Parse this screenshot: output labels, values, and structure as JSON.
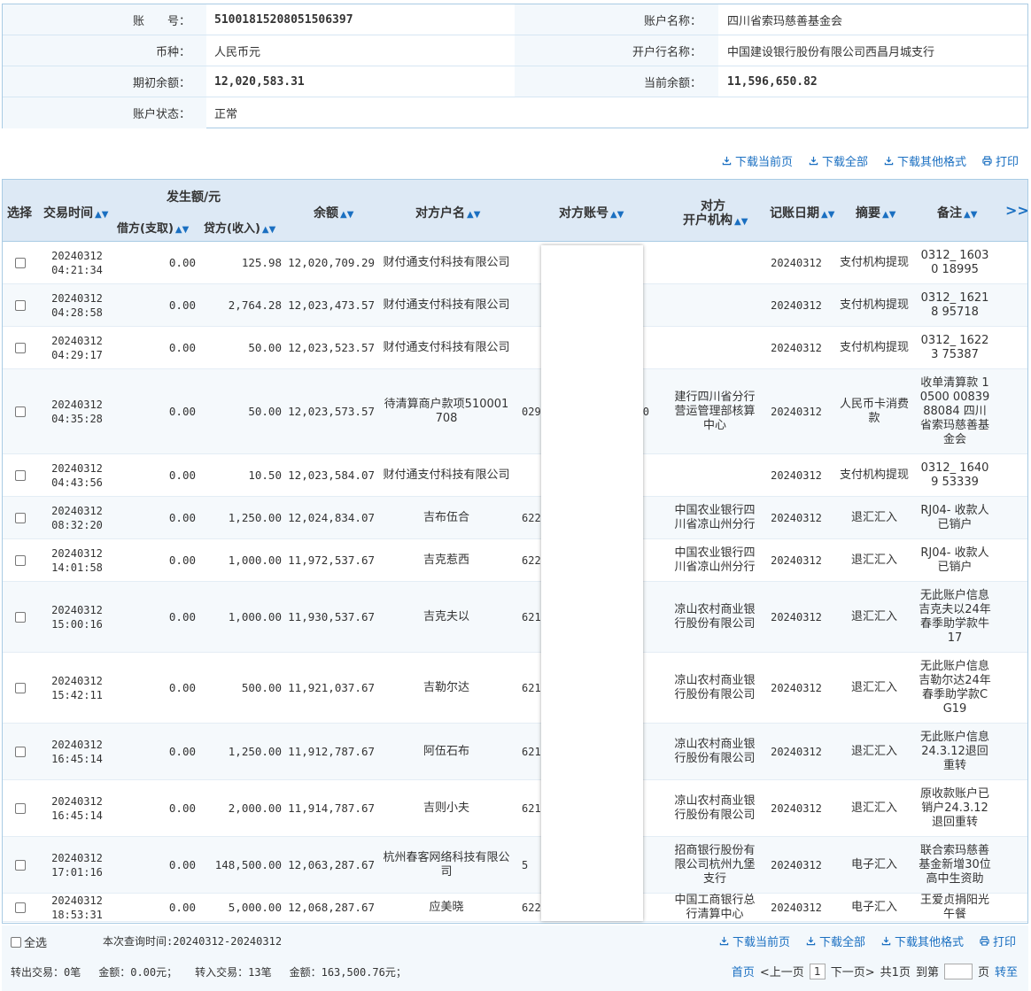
{
  "account": {
    "acct_no_label": "账　　号：",
    "acct_no": "51001815208051506397",
    "acct_name_label": "账户名称：",
    "acct_name": "四川省索玛慈善基金会",
    "currency_label": "币种：",
    "currency": "人民币元",
    "bank_label": "开户行名称：",
    "bank": "中国建设银行股份有限公司西昌月城支行",
    "open_bal_label": "期初余额：",
    "open_bal": "12,020,583.31",
    "cur_bal_label": "当前余额：",
    "cur_bal": "11,596,650.82",
    "status_label": "账户状态：",
    "status": "正常"
  },
  "toolbar": {
    "download_page": "下载当前页",
    "download_all": "下载全部",
    "download_other": "下载其他格式",
    "print": "打印"
  },
  "table": {
    "headers": {
      "select": "选择",
      "time": "交易时间",
      "amount_group": "发生额/元",
      "debit": "借方(支取)",
      "credit": "贷方(收入)",
      "balance": "余额",
      "cp_name": "对方户名",
      "cp_acct": "对方账号",
      "cp_bank_1": "对方",
      "cp_bank_2": "开户机构",
      "post_date": "记账日期",
      "summary": "摘要",
      "remark": "备注",
      "more": ">>"
    },
    "rows": [
      {
        "date": "20240312",
        "time": "04:21:34",
        "debit": "0.00",
        "credit": "125.98",
        "balance": "12,020,709.29",
        "cp_name": "财付通支付科技有限公司",
        "cp_acct": "",
        "cp_bank": "",
        "post_date": "20240312",
        "summary": "支付机构提现",
        "remark": "0312_ 16030 18995"
      },
      {
        "date": "20240312",
        "time": "04:28:58",
        "debit": "0.00",
        "credit": "2,764.28",
        "balance": "12,023,473.57",
        "cp_name": "财付通支付科技有限公司",
        "cp_acct": "",
        "cp_bank": "",
        "post_date": "20240312",
        "summary": "支付机构提现",
        "remark": "0312_ 16218 95718"
      },
      {
        "date": "20240312",
        "time": "04:29:17",
        "debit": "0.00",
        "credit": "50.00",
        "balance": "12,023,523.57",
        "cp_name": "财付通支付科技有限公司",
        "cp_acct": "",
        "cp_bank": "",
        "post_date": "20240312",
        "summary": "支付机构提现",
        "remark": "0312_ 16223 75387"
      },
      {
        "date": "20240312",
        "time": "04:35:28",
        "debit": "0.00",
        "credit": "50.00",
        "balance": "12,023,573.57",
        "cp_name": "待清算商户款项510001708",
        "cp_acct": "029",
        "cp_acct_tail": "0",
        "cp_bank": "建行四川省分行营运管理部核算中心",
        "post_date": "20240312",
        "summary": "人民币卡消费款",
        "remark": "收单清算款 10500 00839 88084 四川省索玛慈善基金会"
      },
      {
        "date": "20240312",
        "time": "04:43:56",
        "debit": "0.00",
        "credit": "10.50",
        "balance": "12,023,584.07",
        "cp_name": "财付通支付科技有限公司",
        "cp_acct": "",
        "cp_bank": "",
        "post_date": "20240312",
        "summary": "支付机构提现",
        "remark": "0312_ 16409 53339"
      },
      {
        "date": "20240312",
        "time": "08:32:20",
        "debit": "0.00",
        "credit": "1,250.00",
        "balance": "12,024,834.07",
        "cp_name": "吉布伍合",
        "cp_acct": "622",
        "cp_bank": "中国农业银行四川省凉山州分行",
        "post_date": "20240312",
        "summary": "退汇汇入",
        "remark": "RJ04- 收款人已销户"
      },
      {
        "date": "20240312",
        "time": "14:01:58",
        "debit": "0.00",
        "credit": "1,000.00",
        "balance": "11,972,537.67",
        "cp_name": "吉克惹西",
        "cp_acct": "622",
        "cp_bank": "中国农业银行四川省凉山州分行",
        "post_date": "20240312",
        "summary": "退汇汇入",
        "remark": "RJ04- 收款人已销户"
      },
      {
        "date": "20240312",
        "time": "15:00:16",
        "debit": "0.00",
        "credit": "1,000.00",
        "balance": "11,930,537.67",
        "cp_name": "吉克夫以",
        "cp_acct": "621",
        "cp_bank": "凉山农村商业银行股份有限公司",
        "post_date": "20240312",
        "summary": "退汇汇入",
        "remark": "无此账户信息吉克夫以24年春季助学款牛17"
      },
      {
        "date": "20240312",
        "time": "15:42:11",
        "debit": "0.00",
        "credit": "500.00",
        "balance": "11,921,037.67",
        "cp_name": "吉勒尔达",
        "cp_acct": "621",
        "cp_bank": "凉山农村商业银行股份有限公司",
        "post_date": "20240312",
        "summary": "退汇汇入",
        "remark": "无此账户信息吉勒尔达24年春季助学款CG19"
      },
      {
        "date": "20240312",
        "time": "16:45:14",
        "debit": "0.00",
        "credit": "1,250.00",
        "balance": "11,912,787.67",
        "cp_name": "阿伍石布",
        "cp_acct": "621",
        "cp_bank": "凉山农村商业银行股份有限公司",
        "post_date": "20240312",
        "summary": "退汇汇入",
        "remark": "无此账户信息24.3.12退回重转"
      },
      {
        "date": "20240312",
        "time": "16:45:14",
        "debit": "0.00",
        "credit": "2,000.00",
        "balance": "11,914,787.67",
        "cp_name": "吉则小夫",
        "cp_acct": "621",
        "cp_bank": "凉山农村商业银行股份有限公司",
        "post_date": "20240312",
        "summary": "退汇汇入",
        "remark": "原收款账户已销户24.3.12退回重转"
      },
      {
        "date": "20240312",
        "time": "17:01:16",
        "debit": "0.00",
        "credit": "148,500.00",
        "balance": "12,063,287.67",
        "cp_name": "杭州春客网络科技有限公司",
        "cp_acct": "5",
        "cp_bank": "招商银行股份有限公司杭州九堡支行",
        "post_date": "20240312",
        "summary": "电子汇入",
        "remark": "联合索玛慈善基金新增30位高中生资助"
      },
      {
        "date": "20240312",
        "time": "18:53:31",
        "debit": "0.00",
        "credit": "5,000.00",
        "balance": "12,068,287.67",
        "cp_name": "应美晓",
        "cp_acct": "622",
        "cp_bank": "中国工商银行总行清算中心",
        "post_date": "20240312",
        "summary": "电子汇入",
        "remark": "王爱贞捐阳光午餐"
      }
    ]
  },
  "footer": {
    "select_all": "全选",
    "query_time": "本次查询时间:20240312-20240312",
    "out_count": "转出交易：0笔",
    "out_amount": "金额：0.00元；",
    "in_count": "转入交易：13笔",
    "in_amount": "金额：163,500.76元；",
    "first": "首页",
    "prev": "<上一页",
    "page": "1",
    "next": "下一页>",
    "total": "共1页",
    "goto": "到第",
    "page_unit": "页",
    "go": "转至"
  }
}
